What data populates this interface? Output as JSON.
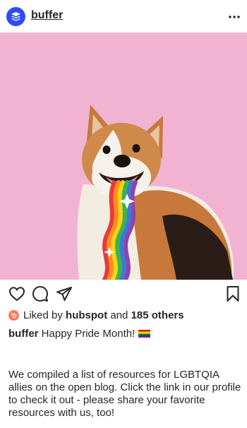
{
  "post": {
    "username": "buffer",
    "avatar_icon": "buffer-stack-logo",
    "more_icon": "more-dots-icon",
    "photo_description_icon": "corgi-rainbow-photo"
  },
  "actions": {
    "like_icon": "heart-icon",
    "comment_icon": "comment-icon",
    "share_icon": "paper-plane-icon",
    "save_icon": "bookmark-icon"
  },
  "likes": {
    "prefix": "Liked by",
    "user": "hubspot",
    "middle": "and",
    "others": "185 others"
  },
  "caption": {
    "username": "buffer",
    "text": "Happy Pride Month!",
    "body": "We compiled a list of resources for LGBTQIA allies on the open blog. Click the link in our profile to check it out - please share your favorite resources with us, too!"
  },
  "colors": {
    "buffer_blue": "#2c4bff",
    "photo_background": "#f2b3d2",
    "hubspot_orange": "#ff7a59"
  }
}
